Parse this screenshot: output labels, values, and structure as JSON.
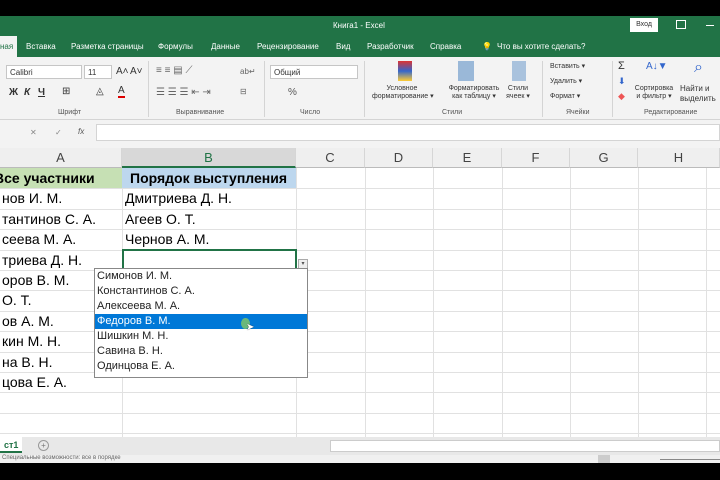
{
  "title": {
    "text": "Книга1  -  Excel",
    "login": "Вход"
  },
  "tabs": [
    {
      "label": "ная"
    },
    {
      "label": "Вставка"
    },
    {
      "label": "Разметка страницы"
    },
    {
      "label": "Формулы"
    },
    {
      "label": "Данные"
    },
    {
      "label": "Рецензирование"
    },
    {
      "label": "Вид"
    },
    {
      "label": "Разработчик"
    },
    {
      "label": "Справка"
    },
    {
      "label": "Что вы хотите сделать?"
    }
  ],
  "ribbon": {
    "font_name": "Calibri",
    "font_size": "11",
    "bold": "Ж",
    "italic": "К",
    "underline": "Ч",
    "number_format": "Общий",
    "percent": "%",
    "cond_format": [
      "Условное",
      "форматирование ▾"
    ],
    "format_table": [
      "Форматировать",
      "как таблицу ▾"
    ],
    "cell_styles": [
      "Стили",
      "ячеек ▾"
    ],
    "insert": "Вставить ▾",
    "delete": "Удалить ▾",
    "format": "Формат ▾",
    "sort": [
      "Сортировка",
      "и фильтр ▾"
    ],
    "find": [
      "Найти и",
      "выделить"
    ],
    "groups": [
      "Шрифт",
      "Выравнивание",
      "Число",
      "Стили",
      "Ячейки",
      "Редактирование"
    ]
  },
  "formula": {
    "fx": "fx",
    "cancel": "✕",
    "ok": "✓"
  },
  "columns": [
    "A",
    "B",
    "C",
    "D",
    "E",
    "F",
    "G",
    "H"
  ],
  "colA": [
    "Все участники",
    "нов И. М.",
    "тантинов С. А.",
    "сеева М. А.",
    "триева Д. Н.",
    "оров В. М.",
    "О. Т.",
    "ов А. М.",
    "кин М. Н.",
    "на В. Н.",
    "цова Е. А."
  ],
  "colB": [
    "Порядок выступления",
    "Дмитриева Д. Н.",
    "Агеев О. Т.",
    "Чернов А. М."
  ],
  "dropdown": [
    "Симонов И. М.",
    "Константинов С. А.",
    "Алексеева М. А.",
    "Федоров В. М.",
    "Шишкин М. Н.",
    "Савина В. Н.",
    "Одинцова Е. А."
  ],
  "selected_index": 3,
  "sheet": {
    "name": "ст1",
    "add": "+"
  },
  "status": {
    "text": "Специальные возможности: все в порядке"
  }
}
